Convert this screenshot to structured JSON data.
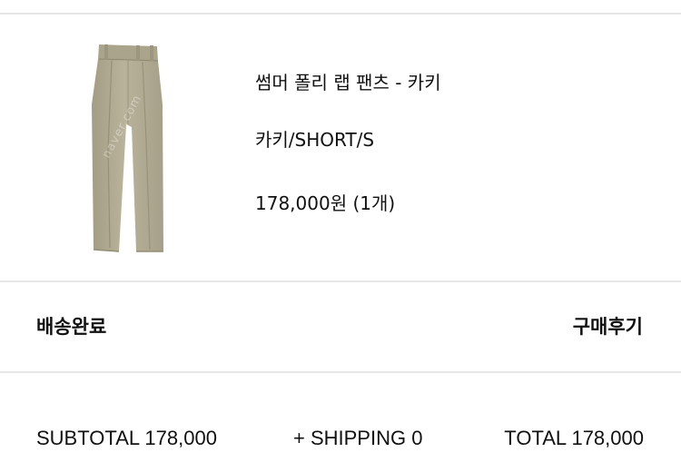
{
  "product": {
    "name": "썸머 폴리 랩 팬츠 - 카키",
    "option": "카키/SHORT/S",
    "price": "178,000원 (1개)",
    "image_color": "#b2ac95",
    "watermark": "naver.com"
  },
  "order": {
    "status": "배송완료",
    "review_button": "구매후기"
  },
  "summary": {
    "subtotal": "SUBTOTAL 178,000",
    "shipping": "+ SHIPPING 0",
    "total": "TOTAL 178,000"
  }
}
